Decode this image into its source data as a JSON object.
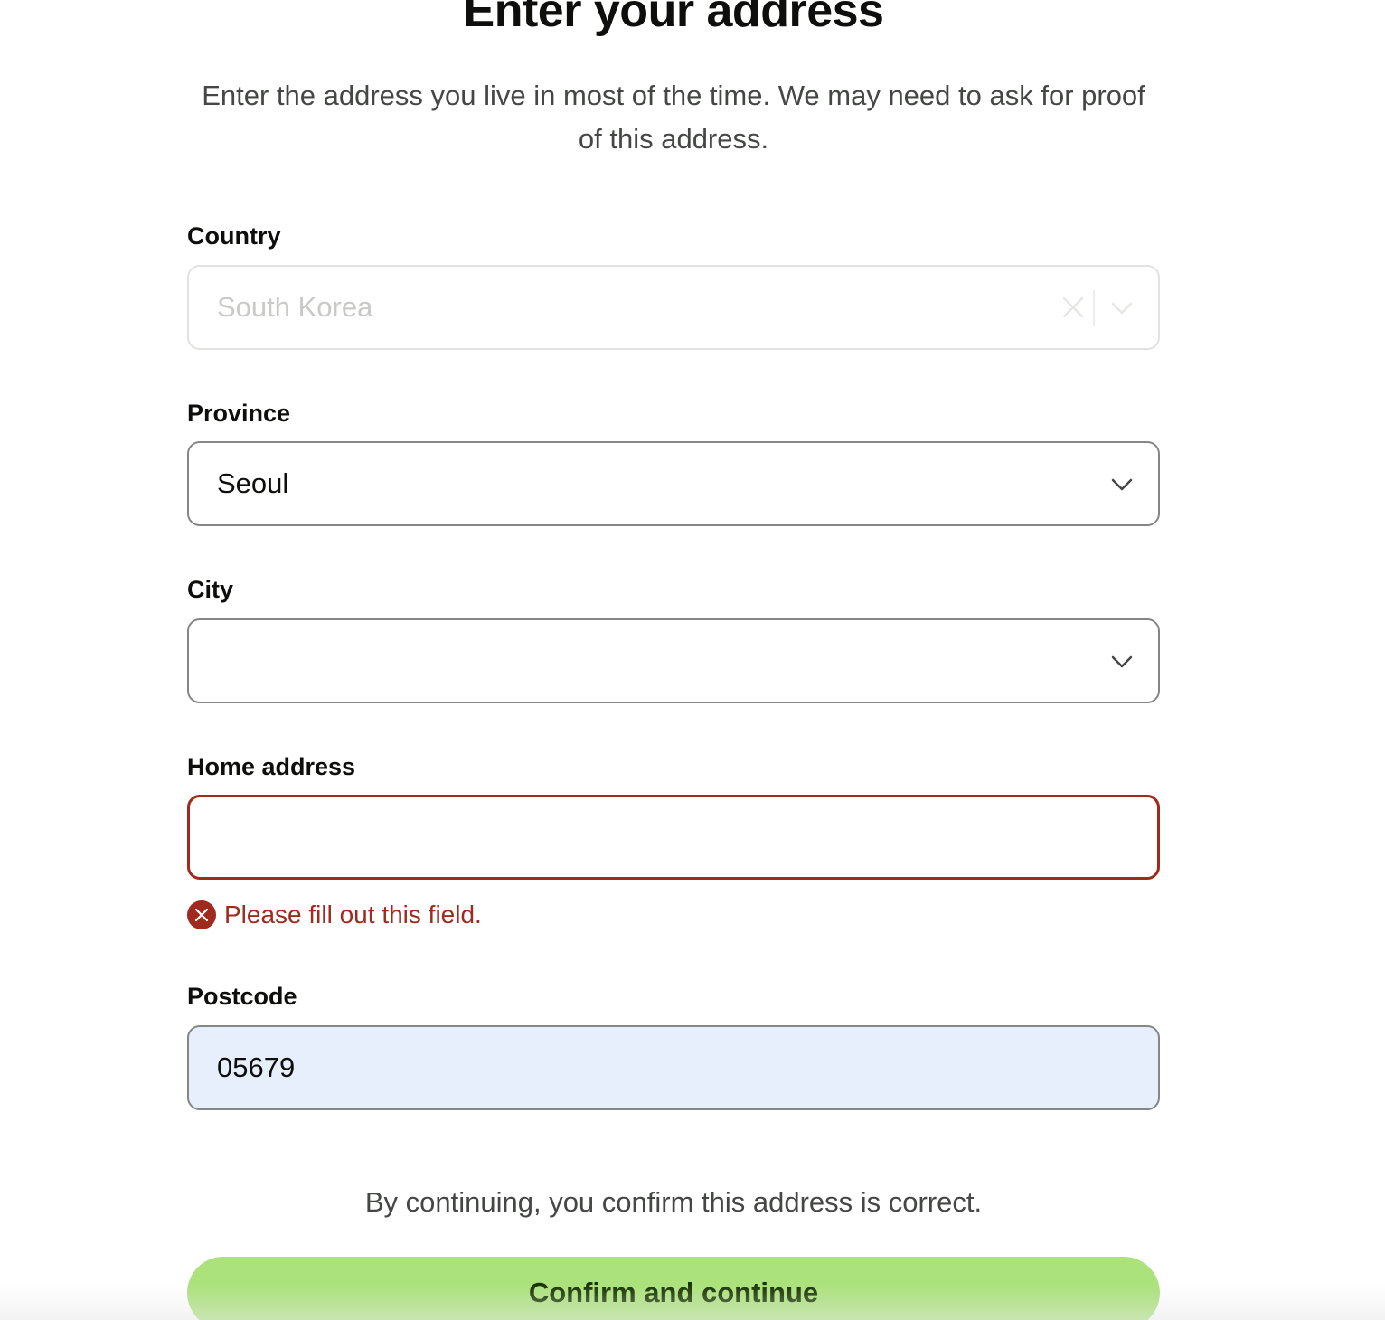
{
  "header": {
    "title": "Enter your address",
    "subtitle": "Enter the address you live in most of the time. We may need to ask for proof of this address."
  },
  "form": {
    "country": {
      "label": "Country",
      "value": "South Korea",
      "disabled": true
    },
    "province": {
      "label": "Province",
      "value": "Seoul"
    },
    "city": {
      "label": "City",
      "value": ""
    },
    "home_address": {
      "label": "Home address",
      "value": "",
      "error": "Please fill out this field."
    },
    "postcode": {
      "label": "Postcode",
      "value": "05679"
    }
  },
  "footer": {
    "note": "By continuing, you confirm this address is correct.",
    "confirm_label": "Confirm and continue"
  },
  "colors": {
    "accent": "#abe27b",
    "error": "#a12a1e",
    "autofill_bg": "#e8effc",
    "text": "#0e0f0c",
    "muted_text": "#454745"
  },
  "icons": {
    "clear": "close-icon",
    "dropdown": "chevron-down-icon",
    "error": "error-circle-icon"
  }
}
